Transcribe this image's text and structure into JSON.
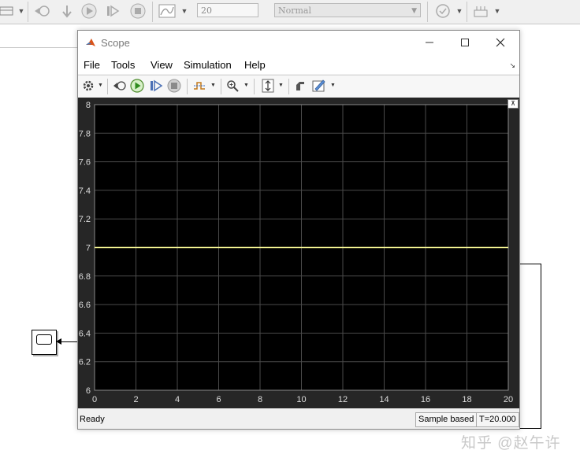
{
  "toolbar": {
    "stop_time": "20",
    "simulation_mode": "Normal",
    "icons": [
      "library-browser-icon",
      "step-back-icon",
      "run-icon",
      "step-forward-icon",
      "stop-icon",
      "scope-settings-icon",
      "model-advisor-icon",
      "build-icon"
    ]
  },
  "scope": {
    "title": "Scope",
    "menu": [
      "File",
      "Tools",
      "View",
      "Simulation",
      "Help"
    ],
    "status": "Ready",
    "status_mode": "Sample based",
    "status_time": "T=20.000",
    "toolbar_icons": [
      "settings-icon",
      "restore-icon",
      "run-icon",
      "step-forward-icon",
      "stop-icon",
      "triggers-icon",
      "zoom-icon",
      "scale-axes-icon",
      "highlight-signal-icon",
      "style-icon"
    ]
  },
  "chart_data": {
    "type": "line",
    "title": "",
    "xlabel": "",
    "ylabel": "",
    "xlim": [
      0,
      20
    ],
    "ylim": [
      6,
      8
    ],
    "xticks": [
      0,
      2,
      4,
      6,
      8,
      10,
      12,
      14,
      16,
      18,
      20
    ],
    "yticks": [
      6,
      6.2,
      6.4,
      6.6,
      6.8,
      7,
      7.2,
      7.4,
      7.6,
      7.8,
      8
    ],
    "grid": true,
    "background": "#000000",
    "series": [
      {
        "x": [
          0,
          20
        ],
        "y": [
          7,
          7
        ],
        "color": "#ffff99"
      }
    ]
  },
  "watermark": "知乎 @赵午许"
}
